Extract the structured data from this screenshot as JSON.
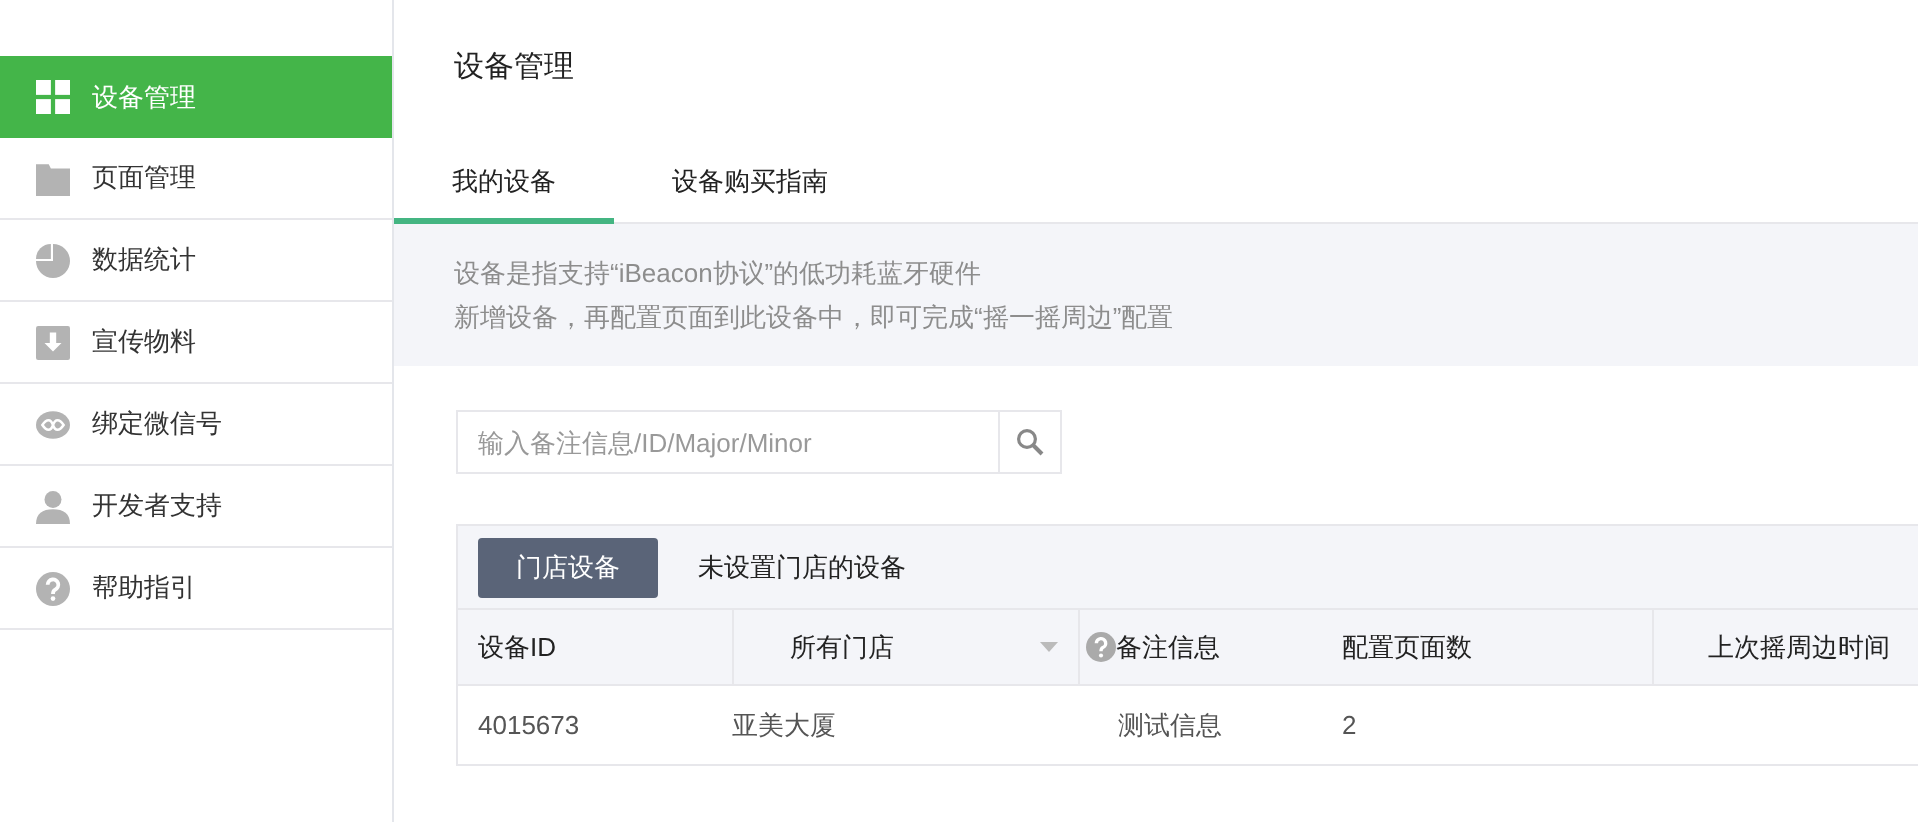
{
  "sidebar": {
    "items": [
      {
        "label": "设备管理",
        "kind": "grid",
        "selected": true
      },
      {
        "label": "页面管理",
        "kind": "folder",
        "selected": false
      },
      {
        "label": "数据统计",
        "kind": "pie",
        "selected": false
      },
      {
        "label": "宣传物料",
        "kind": "download",
        "selected": false
      },
      {
        "label": "绑定微信号",
        "kind": "link",
        "selected": false
      },
      {
        "label": "开发者支持",
        "kind": "person",
        "selected": false
      },
      {
        "label": "帮助指引",
        "kind": "help",
        "selected": false
      }
    ]
  },
  "page_title": "设备管理",
  "tabs": [
    {
      "label": "我的设备",
      "selected": true
    },
    {
      "label": "设备购买指南",
      "selected": false
    }
  ],
  "notice": [
    "设备是指支持“iBeacon协议”的低功耗蓝牙硬件",
    "新增设备，再配置页面到此设备中，即可完成“摇一摇周边”配置"
  ],
  "search": {
    "placeholder": "输入备注信息/ID/Major/Minor"
  },
  "filters": [
    {
      "label": "门店设备",
      "selected": true
    },
    {
      "label": "未设置门店的设备",
      "selected": false
    }
  ],
  "table": {
    "columns": [
      {
        "label": "设备ID",
        "kind": "plain"
      },
      {
        "label": "所有门店",
        "kind": "dropdown"
      },
      {
        "label": "备注信息",
        "kind": "help"
      },
      {
        "label": "配置页面数",
        "kind": "plain"
      },
      {
        "label": "上次摇周边时间",
        "kind": "plain"
      }
    ],
    "rows": [
      [
        "4015673",
        "亚美大厦",
        "测试信息",
        "2",
        ""
      ]
    ]
  }
}
